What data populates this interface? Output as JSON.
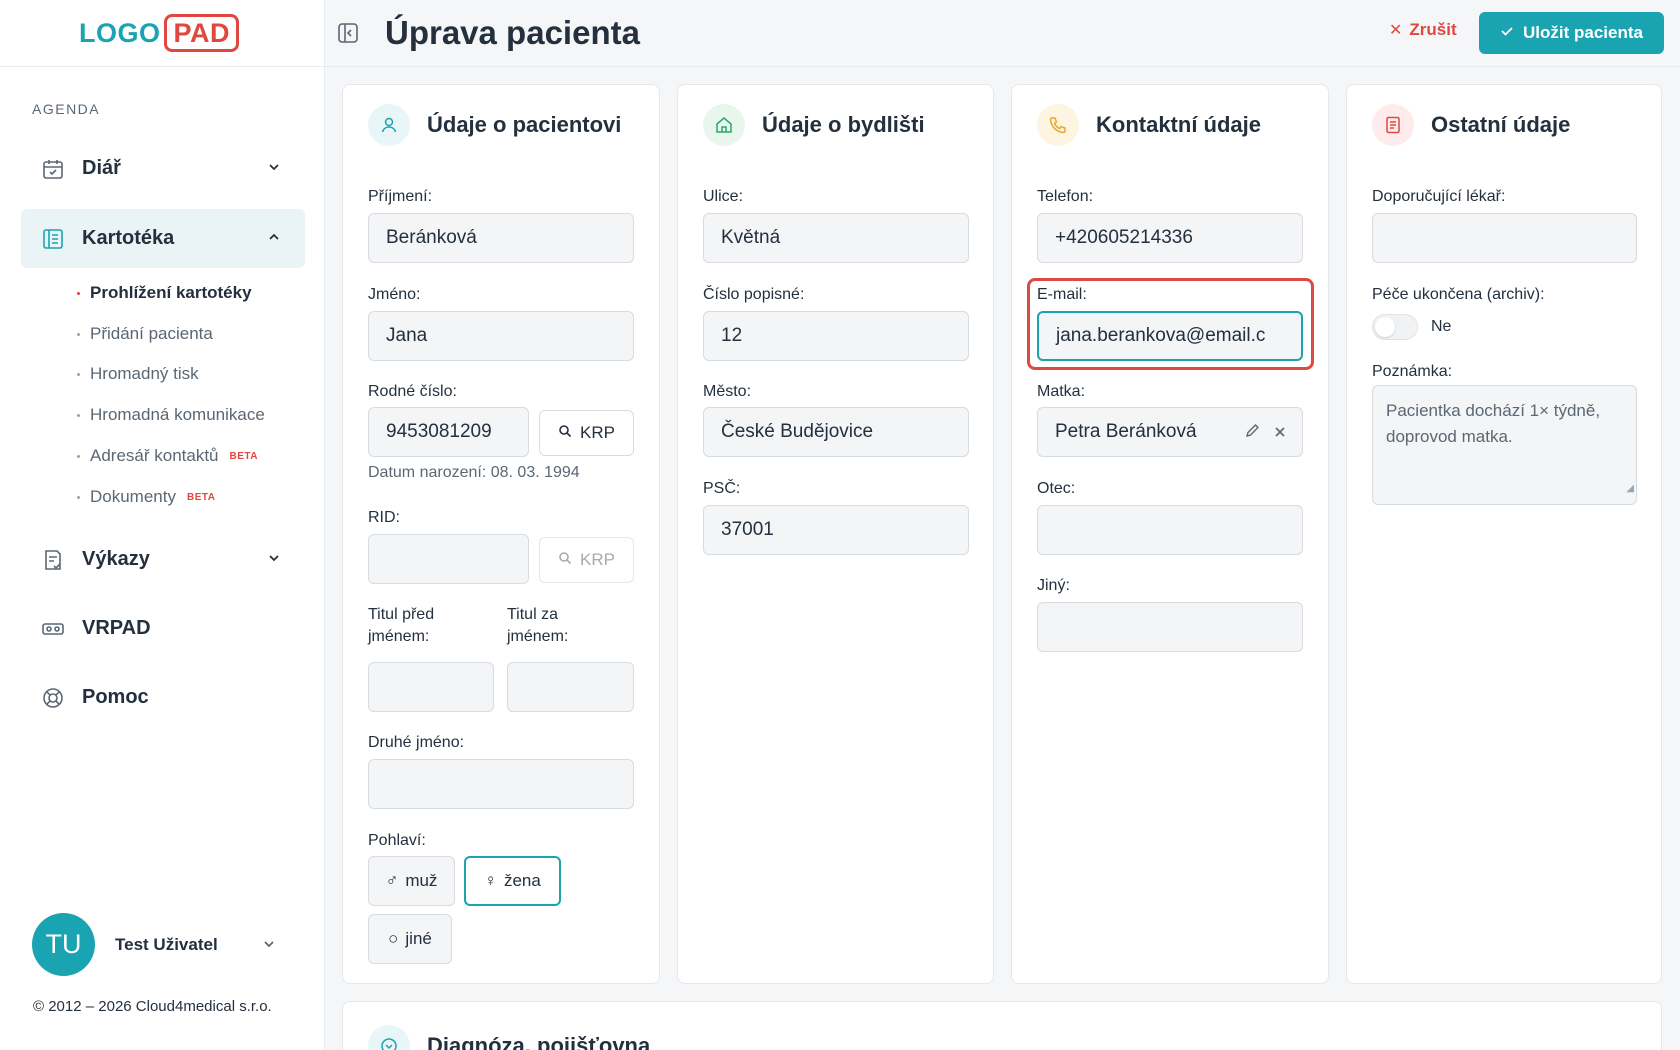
{
  "logo": {
    "left": "LOGO",
    "right": "PAD"
  },
  "sidebar": {
    "section_label": "AGENDA",
    "items": [
      {
        "label": "Diář",
        "icon": "calendar-check-icon"
      },
      {
        "label": "Kartotéka",
        "icon": "card-index-icon"
      },
      {
        "label": "Výkazy",
        "icon": "report-icon"
      },
      {
        "label": "VRPAD",
        "icon": "vr-headset-icon"
      },
      {
        "label": "Pomoc",
        "icon": "lifebuoy-icon"
      }
    ],
    "subitems": [
      {
        "label": "Prohlížení kartotéky"
      },
      {
        "label": "Přidání pacienta"
      },
      {
        "label": "Hromadný tisk"
      },
      {
        "label": "Hromadná komunikace"
      },
      {
        "label": "Adresář kontaktů",
        "badge": "BETA"
      },
      {
        "label": "Dokumenty",
        "badge": "BETA"
      }
    ],
    "user": {
      "initials": "TU",
      "name": "Test Uživatel"
    },
    "copyright": "© 2012 – 2026 Cloud4medical s.r.o."
  },
  "header": {
    "title": "Úprava pacienta",
    "cancel_label": "Zrušit",
    "save_label": "Uložit pacienta"
  },
  "cards": {
    "patient": {
      "title": "Údaje o pacientovi",
      "surname_label": "Příjmení:",
      "surname": "Beránková",
      "firstname_label": "Jméno:",
      "firstname": "Jana",
      "birthnum_label": "Rodné číslo:",
      "birthnum": "9453081209",
      "krp_label": "KRP",
      "birthdate_hint": "Datum narození: 08. 03. 1994",
      "rid_label": "RID:",
      "rid": "",
      "title_before_label_1": "Titul před",
      "title_before_label_2": "jménem:",
      "title_after_label_1": "Titul za",
      "title_after_label_2": "jménem:",
      "middlename_label": "Druhé jméno:",
      "gender_label": "Pohlaví:",
      "gender_male": "muž",
      "gender_female": "žena",
      "gender_other": "jiné",
      "gender_selected": "žena"
    },
    "residence": {
      "title": "Údaje o bydlišti",
      "street_label": "Ulice:",
      "street": "Květná",
      "number_label": "Číslo popisné:",
      "number": "12",
      "city_label": "Město:",
      "city": "České Budějovice",
      "zip_label": "PSČ:",
      "zip": "37001"
    },
    "contact": {
      "title": "Kontaktní údaje",
      "phone_label": "Telefon:",
      "phone": "+420605214336",
      "email_label": "E-mail:",
      "email": "jana.berankova@email.c",
      "mother_label": "Matka:",
      "mother": "Petra Beránková",
      "father_label": "Otec:",
      "father": "",
      "other_label": "Jiný:",
      "other": ""
    },
    "other": {
      "title": "Ostatní údaje",
      "doctor_label": "Doporučující lékař:",
      "doctor": "",
      "archive_label": "Péče ukončena (archiv):",
      "archive_value": "Ne",
      "note_label": "Poznámka:",
      "note": "Pacientka dochází 1× týdně, doprovod matka."
    },
    "diagnosis": {
      "title": "Diagnóza, pojišťovna"
    }
  },
  "colors": {
    "accent": "#1aa3b0",
    "danger": "#e0483f",
    "text": "#24303d"
  }
}
